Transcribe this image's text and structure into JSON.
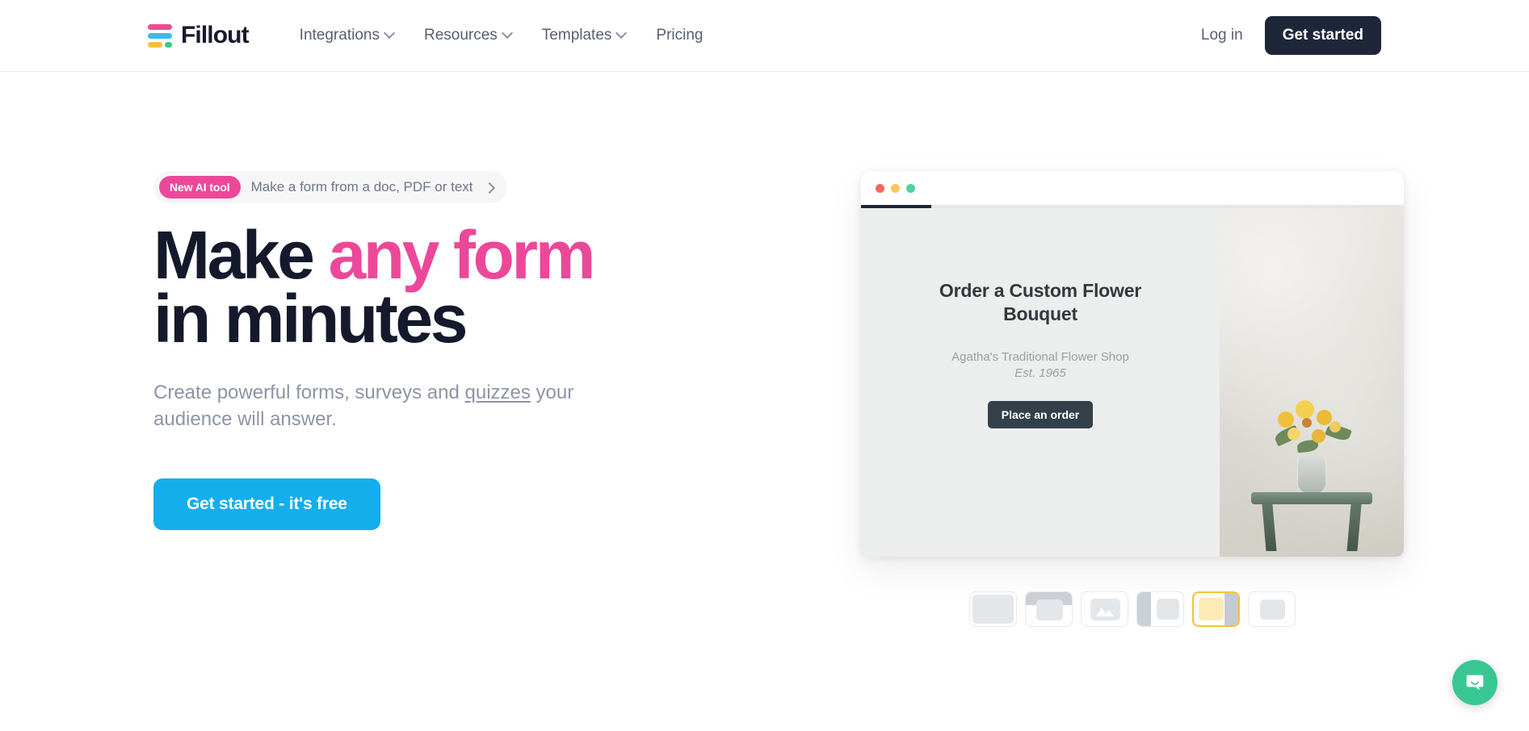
{
  "brand": {
    "name": "Fillout",
    "logo_colors": {
      "pink": "#ef4a94",
      "blue": "#3cb9ee",
      "yellow": "#f8c13c",
      "green": "#36cb8b"
    }
  },
  "header": {
    "nav": [
      {
        "label": "Integrations",
        "has_dropdown": true
      },
      {
        "label": "Resources",
        "has_dropdown": true
      },
      {
        "label": "Templates",
        "has_dropdown": true
      },
      {
        "label": "Pricing",
        "has_dropdown": false
      }
    ],
    "login_label": "Log in",
    "get_started_label": "Get started"
  },
  "hero": {
    "pill": {
      "badge": "New AI tool",
      "text": "Make a form from a doc, PDF or text"
    },
    "headline": {
      "line1_part1": "Make ",
      "line1_accent": "any form",
      "line2": "in minutes",
      "accent_color": "#ec4899"
    },
    "subhead": {
      "before": "Create powerful forms, surveys and ",
      "link": "quizzes",
      "after": " your audience will answer."
    },
    "cta_label": "Get started - it's free",
    "cta_color": "#14aeec"
  },
  "mockup": {
    "window_controls": [
      "red",
      "yellow",
      "green"
    ],
    "progress_percent": 13,
    "form": {
      "title": "Order a Custom Flower Bouquet",
      "shop_name": "Agatha's Traditional Flower Shop",
      "established": "Est. 1965",
      "button_label": "Place an order"
    },
    "layout_thumbnails": [
      {
        "name": "blank-layout",
        "selected": false
      },
      {
        "name": "header-card-layout",
        "selected": false
      },
      {
        "name": "image-layout",
        "selected": false
      },
      {
        "name": "left-image-layout",
        "selected": false
      },
      {
        "name": "right-image-layout",
        "selected": true
      },
      {
        "name": "centered-card-layout",
        "selected": false
      }
    ],
    "selected_thumbnail_index": 4,
    "selected_border_color": "#f5c231"
  },
  "chat": {
    "icon": "chat-bubble-icon",
    "color": "#38c793"
  }
}
